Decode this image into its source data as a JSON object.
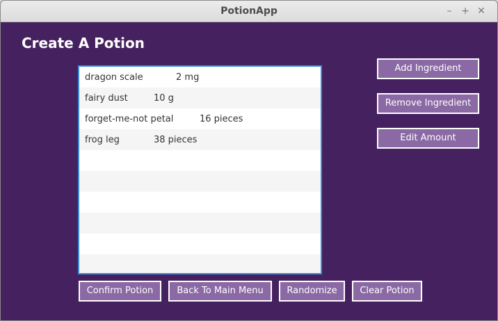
{
  "window": {
    "title": "PotionApp",
    "controls": {
      "minimize": "–",
      "maximize": "+",
      "close": "✕"
    }
  },
  "page": {
    "heading": "Create A Potion"
  },
  "ingredients": [
    {
      "name": "dragon scale",
      "amount": "2 mg"
    },
    {
      "name": "fairy dust",
      "amount": "10 g"
    },
    {
      "name": "forget-me-not petal",
      "amount": "16 pieces"
    },
    {
      "name": "frog leg",
      "amount": "38 pieces"
    }
  ],
  "side_buttons": {
    "add": "Add Ingredient",
    "remove": "Remove Ingredient",
    "edit": "Edit Amount"
  },
  "bottom_buttons": {
    "confirm": "Confirm Potion",
    "back": "Back To Main Menu",
    "randomize": "Randomize",
    "clear": "Clear Potion"
  },
  "colors": {
    "background": "#46215f",
    "button": "#8a69a4",
    "list_border": "#3a8fd6"
  }
}
